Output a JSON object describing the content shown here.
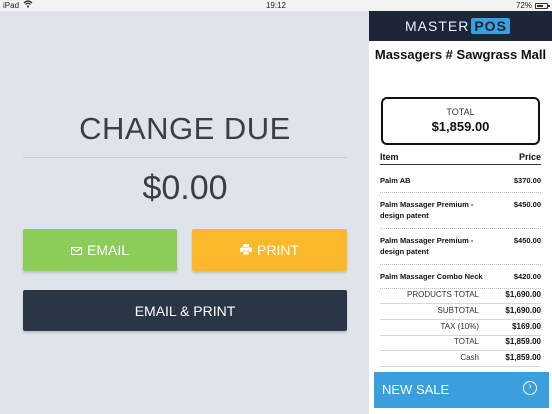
{
  "status_bar": {
    "device": "iPad",
    "time": "19:12",
    "battery_text": "72%",
    "battery_level": 0.72
  },
  "main": {
    "title": "CHANGE DUE",
    "amount": "$0.00",
    "buttons": {
      "email": "EMAIL",
      "print": "PRINT",
      "email_print": "EMAIL & PRINT"
    }
  },
  "receipt": {
    "logo": {
      "left": "MASTER",
      "right": "POS"
    },
    "store_name": "Massagers # Sawgrass Mall",
    "total_box": {
      "label": "TOTAL",
      "amount": "$1,859.00"
    },
    "columns": {
      "item": "Item",
      "price": "Price"
    },
    "items": [
      {
        "name": "Palm AB",
        "price": "$370.00"
      },
      {
        "name": "Palm Massager Premium - design patent",
        "price": "$450.00"
      },
      {
        "name": "Palm Massager Premium - design patent",
        "price": "$450.00"
      },
      {
        "name": "Palm Massager Combo Neck",
        "price": "$420.00"
      }
    ],
    "summary": [
      {
        "label": "PRODUCTS TOTAL",
        "value": "$1,690.00"
      },
      {
        "label": "SUBTOTAL",
        "value": "$1,690.00"
      },
      {
        "label": "TAX (10%)",
        "value": "$169.00"
      },
      {
        "label": "TOTAL",
        "value": "$1,859.00"
      },
      {
        "label": "Cash",
        "value": "$1,859.00"
      }
    ],
    "new_sale_label": "NEW SALE"
  },
  "colors": {
    "email_button": "#8ccd5a",
    "print_button": "#fbb82b",
    "email_print_button": "#2a3545",
    "new_sale_button": "#3a9fdc",
    "logo_bar": "#1d2637"
  }
}
